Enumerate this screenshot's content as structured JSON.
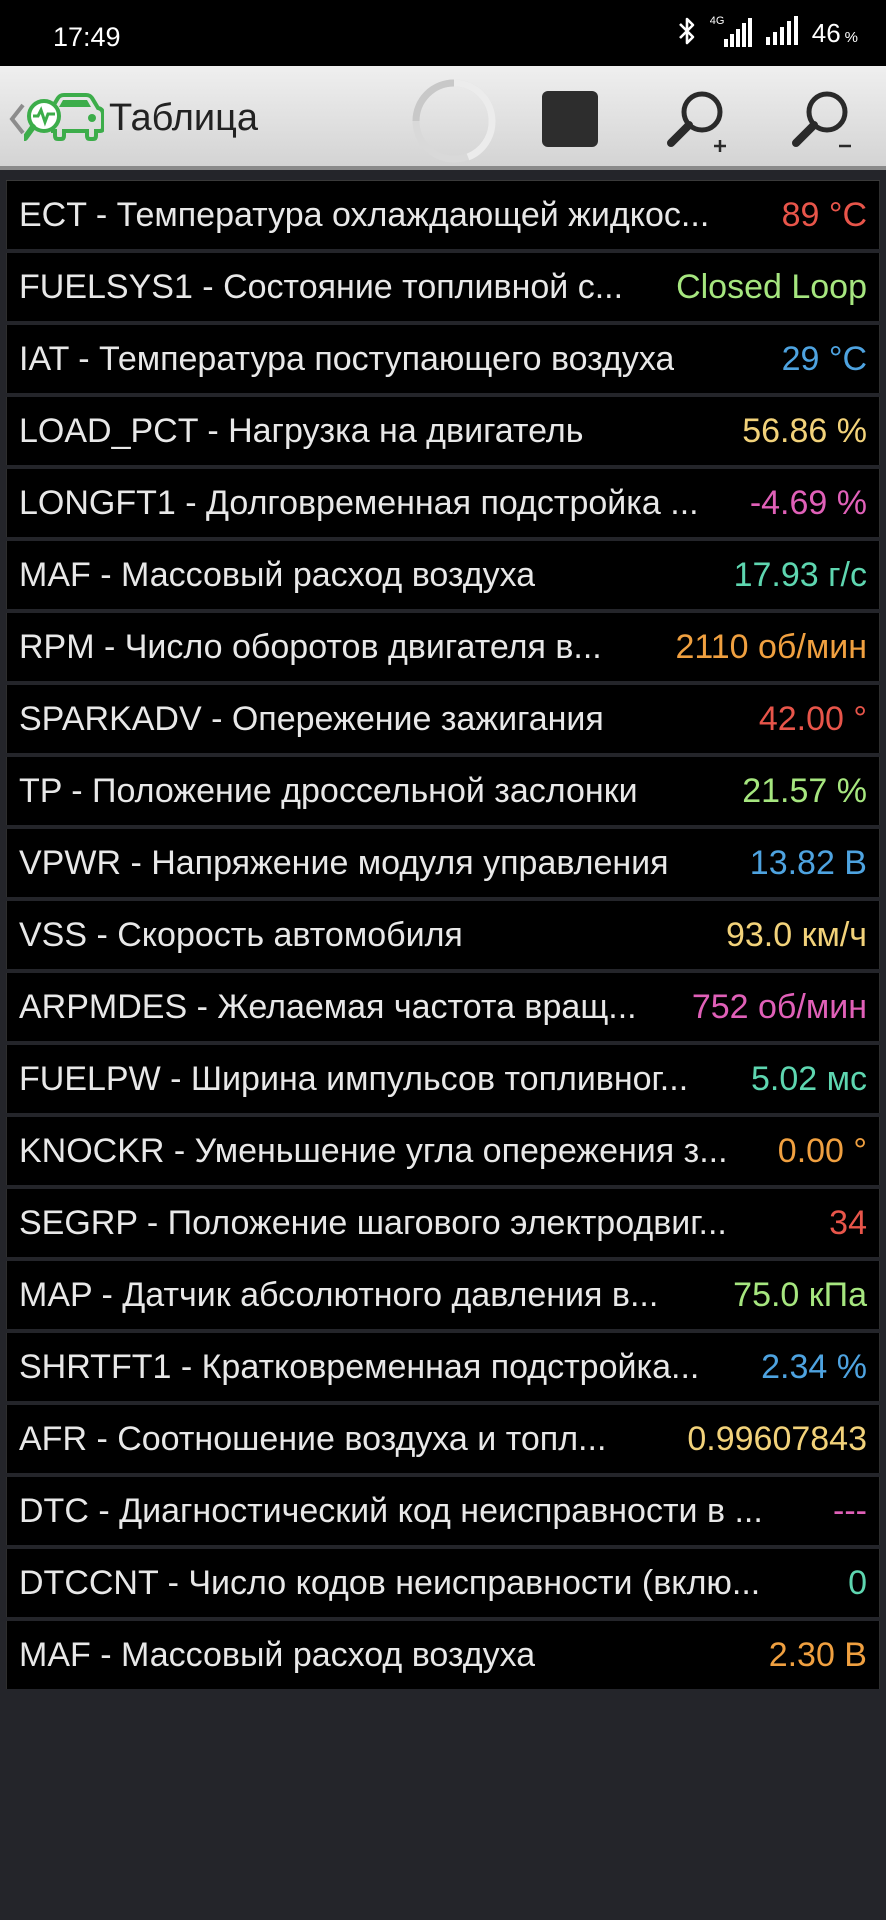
{
  "status_bar": {
    "time": "17:49",
    "network": "4G",
    "battery": "46",
    "battery_unit": "%",
    "icons": [
      "bluetooth-icon",
      "signal-icon",
      "signal-icon-2"
    ]
  },
  "toolbar": {
    "title": "Таблица",
    "icons": [
      "back-chevron-icon",
      "car-logo-icon",
      "progress-spinner-icon",
      "stop-icon",
      "zoom-in-icon",
      "zoom-out-icon"
    ]
  },
  "rows": [
    {
      "label": "ECT - Температура охлаждающей жидкос...",
      "value": "89 °C",
      "color": "#e8554a"
    },
    {
      "label": "FUELSYS1 - Состояние топливной с...",
      "value": "Closed Loop",
      "color": "#a6e67f"
    },
    {
      "label": "IAT - Температура поступающего воздуха",
      "value": "29 °C",
      "color": "#4ea3e0"
    },
    {
      "label": "LOAD_PCT - Нагрузка на двигатель",
      "value": "56.86 %",
      "color": "#f2d27a"
    },
    {
      "label": "LONGFT1 - Долговременная подстройка ...",
      "value": "-4.69 %",
      "color": "#e060b8"
    },
    {
      "label": "MAF - Массовый расход воздуха",
      "value": "17.93 г/с",
      "color": "#5ed6b0"
    },
    {
      "label": "RPM - Число оборотов двигателя в...",
      "value": "2110 об/мин",
      "color": "#f0a040"
    },
    {
      "label": "SPARKADV - Опережение зажигания",
      "value": "42.00 °",
      "color": "#e8554a"
    },
    {
      "label": "TP - Положение дроссельной заслонки",
      "value": "21.57 %",
      "color": "#a6e67f"
    },
    {
      "label": "VPWR - Напряжение модуля управления",
      "value": "13.82 В",
      "color": "#4ea3e0"
    },
    {
      "label": "VSS - Скорость автомобиля",
      "value": "93.0 км/ч",
      "color": "#f2d27a"
    },
    {
      "label": "ARPMDES - Желаемая частота вращ...",
      "value": "752 об/мин",
      "color": "#e060b8"
    },
    {
      "label": "FUELPW - Ширина импульсов топливног...",
      "value": "5.02 мс",
      "color": "#5ed6b0"
    },
    {
      "label": "KNOCKR - Уменьшение угла опережения з...",
      "value": "0.00 °",
      "color": "#f0a040"
    },
    {
      "label": "SEGRP - Положение шагового электродвиг...",
      "value": "34",
      "color": "#e8554a"
    },
    {
      "label": "MAP - Датчик абсолютного давления в...",
      "value": "75.0 кПа",
      "color": "#a6e67f"
    },
    {
      "label": "SHRTFT1 - Кратковременная подстройка...",
      "value": "2.34 %",
      "color": "#4ea3e0"
    },
    {
      "label": "AFR - Соотношение воздуха и топл...",
      "value": "0.99607843",
      "color": "#f2d27a"
    },
    {
      "label": "DTC - Диагностический код неисправности в ...",
      "value": "---",
      "color": "#e060b8"
    },
    {
      "label": "DTCCNT - Число кодов неисправности (вклю...",
      "value": "0",
      "color": "#5ed6b0"
    },
    {
      "label": "MAF - Массовый расход воздуха",
      "value": "2.30 В",
      "color": "#f0a040"
    }
  ]
}
